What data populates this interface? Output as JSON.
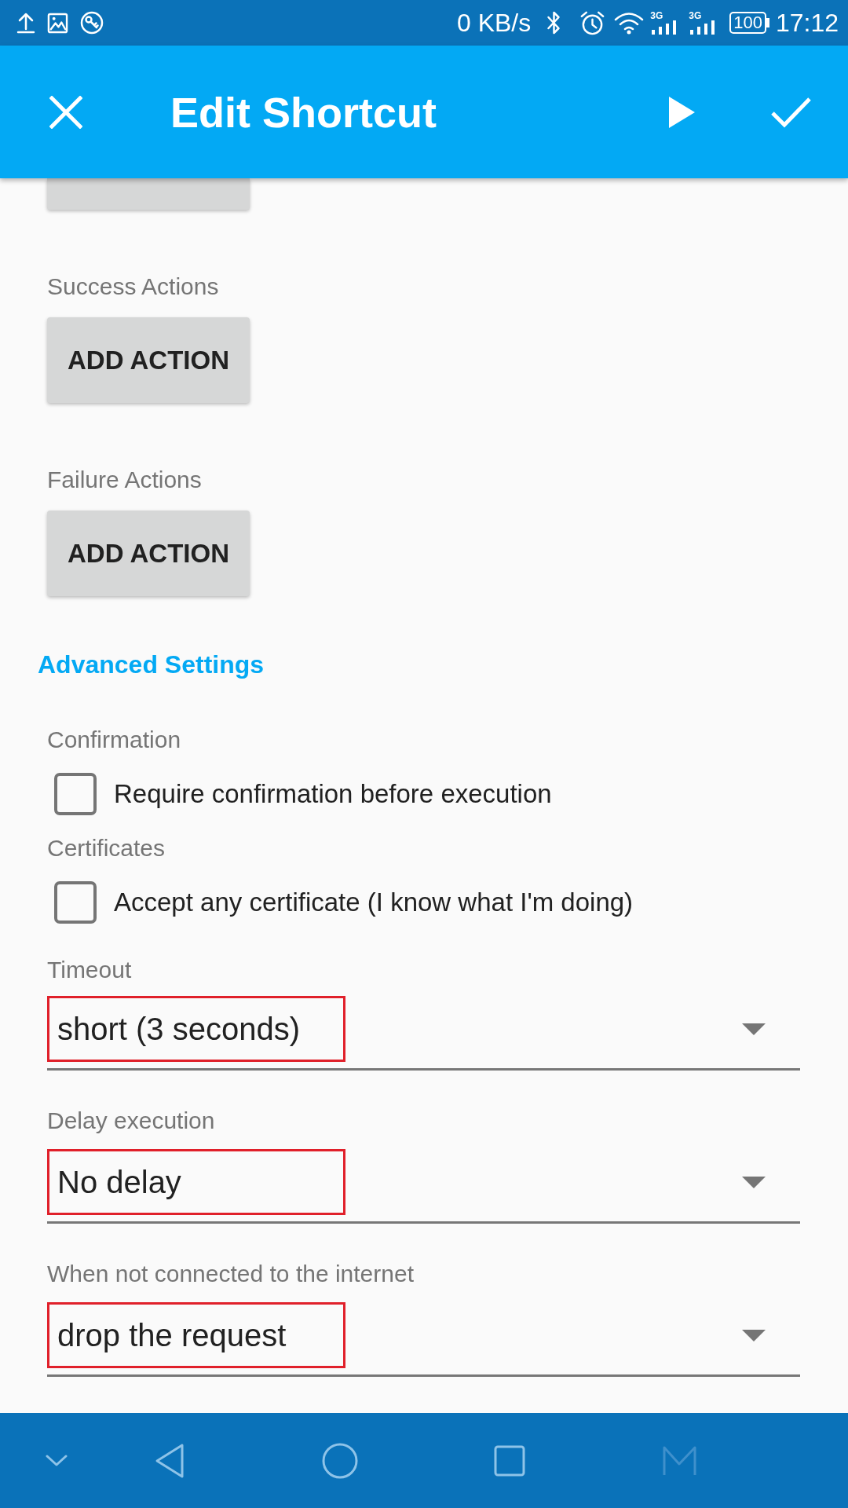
{
  "status_bar": {
    "network_speed": "0 KB/s",
    "networks": [
      {
        "label": "3G"
      },
      {
        "label": "3G"
      }
    ],
    "battery": "100",
    "time": "17:12"
  },
  "app_bar": {
    "title": "Edit Shortcut"
  },
  "content": {
    "top_button_cut_off": true,
    "action_groups": [
      {
        "label": "Success Actions",
        "button": "ADD ACTION"
      },
      {
        "label": "Failure Actions",
        "button": "ADD ACTION"
      }
    ]
  },
  "advanced_settings": {
    "heading": "Advanced Settings",
    "checkboxes": [
      {
        "label": "Confirmation",
        "text": "Require confirmation before execution",
        "checked": false
      },
      {
        "label": "Certificates",
        "text": "Accept any certificate (I know what I'm doing)",
        "checked": false
      }
    ],
    "dropdowns": [
      {
        "label": "Timeout",
        "value": "short (3 seconds)",
        "highlighted": true
      },
      {
        "label": "Delay execution",
        "value": "No delay",
        "highlighted": true
      },
      {
        "label": "When not connected to the internet",
        "value": "drop the request",
        "highlighted": true
      }
    ]
  }
}
